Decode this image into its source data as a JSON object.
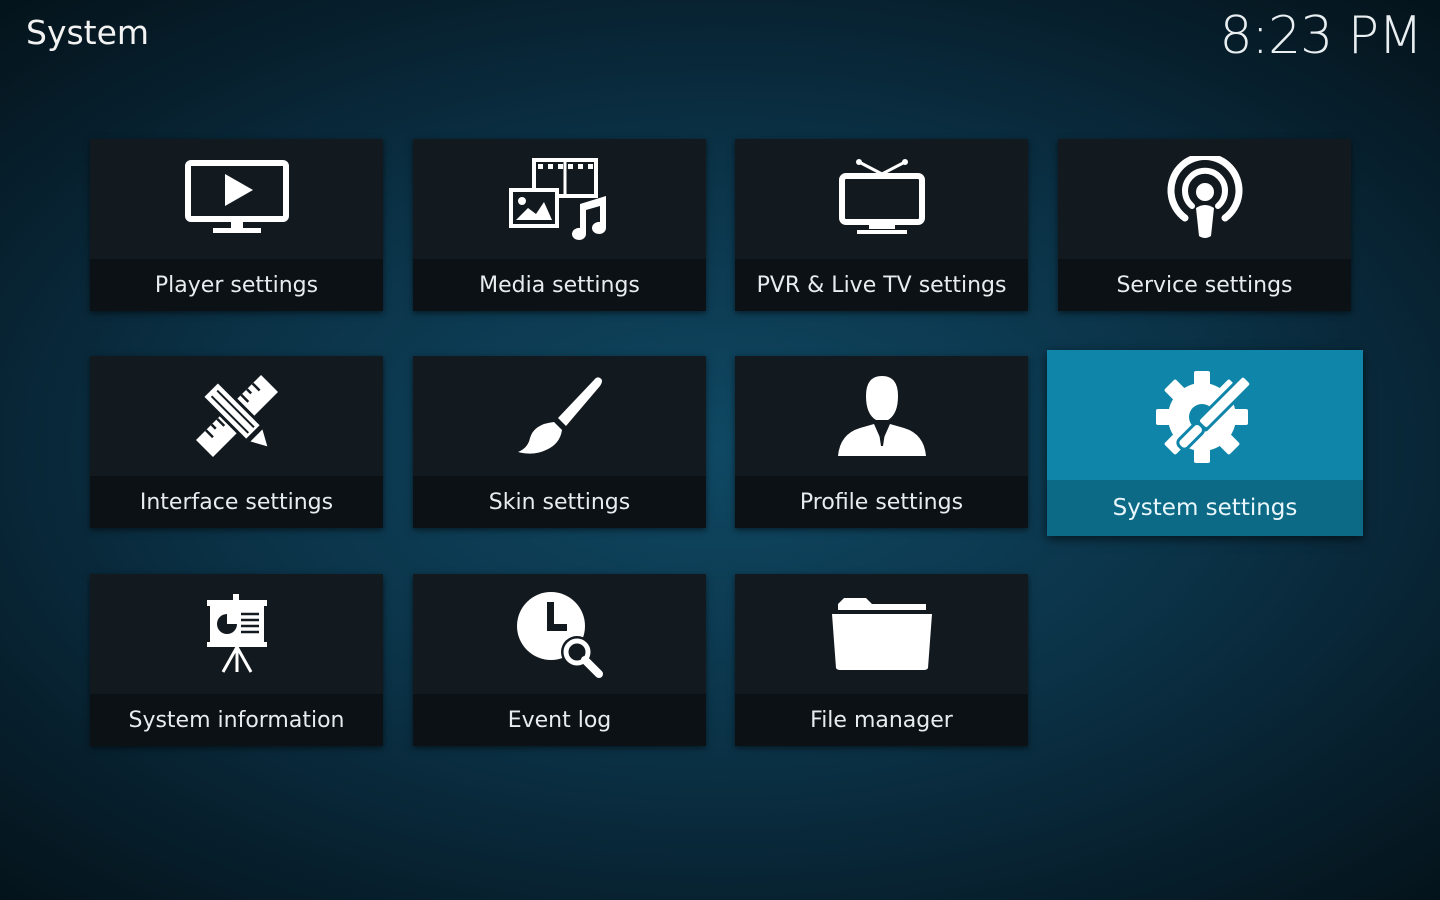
{
  "header": {
    "title": "System",
    "clock": "8:23 PM"
  },
  "tiles": [
    {
      "label": "Player settings",
      "icon": "tv-play-icon"
    },
    {
      "label": "Media settings",
      "icon": "media-icon"
    },
    {
      "label": "PVR & Live TV settings",
      "icon": "live-tv-icon"
    },
    {
      "label": "Service settings",
      "icon": "broadcast-icon"
    },
    {
      "label": "Interface settings",
      "icon": "pencil-ruler-icon"
    },
    {
      "label": "Skin settings",
      "icon": "paintbrush-icon"
    },
    {
      "label": "Profile settings",
      "icon": "user-profile-icon"
    },
    {
      "label": "System settings",
      "icon": "gear-wrench-icon",
      "focused": true
    },
    {
      "label": "System information",
      "icon": "presentation-board-icon"
    },
    {
      "label": "Event log",
      "icon": "clock-search-icon"
    },
    {
      "label": "File manager",
      "icon": "folder-icon"
    }
  ],
  "colors": {
    "focus": "#0f86a9",
    "focus_label_bg": "#0c6a86",
    "tile_bg": "#12191f",
    "tile_label_bg": "#0b1115"
  }
}
